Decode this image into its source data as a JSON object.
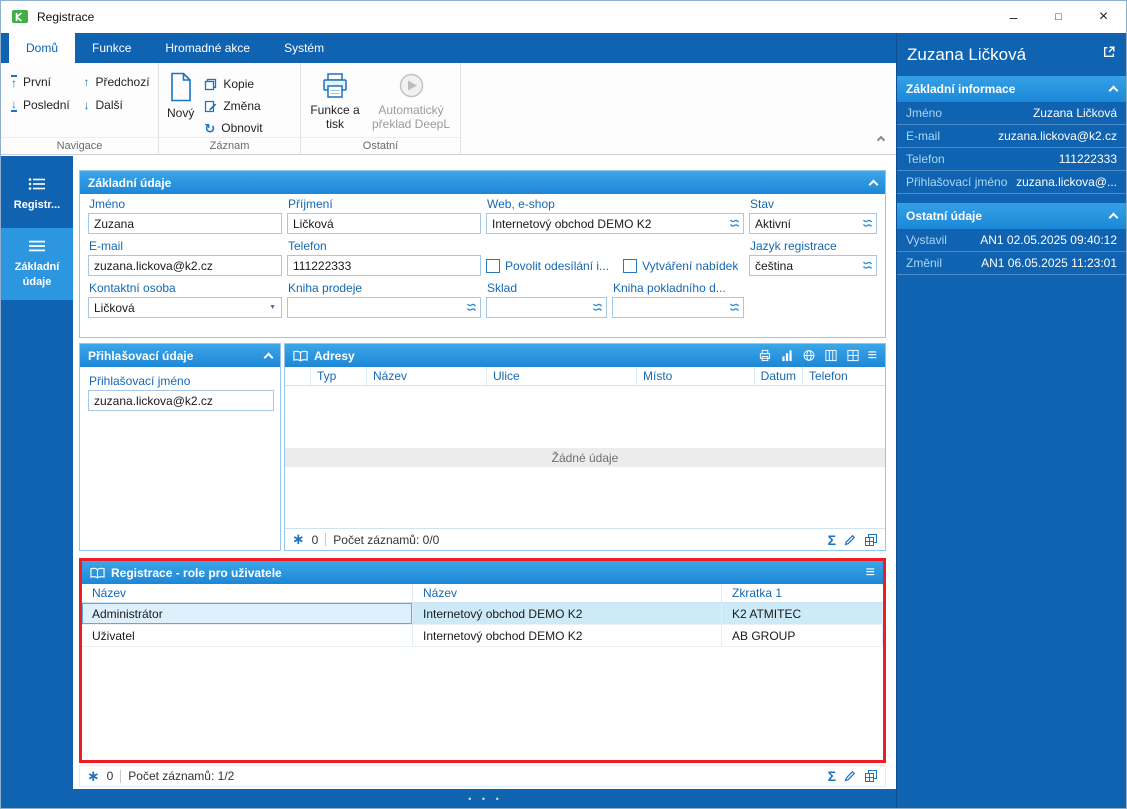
{
  "window": {
    "title": "Registrace"
  },
  "icons": {
    "minimize": "–",
    "maximize": "□",
    "close": "×",
    "menu": "≡",
    "sum": "Σ",
    "flag": "∗",
    "combo_arrow": "▼",
    "arrow_up": "↑",
    "arrow_down": "↓",
    "refresh": "↻",
    "dots": "• • •"
  },
  "colors": {
    "accent_blue": "#0f63b1",
    "header_blue": "#1d87d7",
    "highlight_red": "#ee1c25",
    "selected_row": "#cdeaf9"
  },
  "ribbon": {
    "tabs": [
      {
        "label": "Domů"
      },
      {
        "label": "Funkce"
      },
      {
        "label": "Hromadné akce"
      },
      {
        "label": "Systém"
      }
    ],
    "navigace": {
      "label": "Navigace",
      "first": "První",
      "prev": "Předchozí",
      "last": "Poslední",
      "next": "Další"
    },
    "zaznam": {
      "label": "Záznam",
      "new": "Nový",
      "copy": "Kopie",
      "change": "Změna",
      "refresh": "Obnovit"
    },
    "ostatni": {
      "label": "Ostatní",
      "print": "Funkce a tisk",
      "deepl": "Automatický překlad DeepL"
    }
  },
  "nav_sidebar": {
    "item1": "Registr...",
    "item2": "Základní údaje"
  },
  "form": {
    "title": "Základní údaje",
    "jmeno_label": "Jméno",
    "jmeno": "Zuzana",
    "prijmeni_label": "Příjmení",
    "prijmeni": "Ličková",
    "web_label": "Web, e-shop",
    "web": "Internetový obchod DEMO K2",
    "stav_label": "Stav",
    "stav": "Aktivní",
    "email_label": "E-mail",
    "email": "zuzana.lickova@k2.cz",
    "telefon_label": "Telefon",
    "telefon": "111222333",
    "povolit_label": "Povolit odesílání i...",
    "nabidky_label": "Vytváření nabídek",
    "jazyk_label": "Jazyk registrace",
    "jazyk": "čeština",
    "kontakt_label": "Kontaktní osoba",
    "kontakt": "Ličková",
    "kniha_prodeje_label": "Kniha prodeje",
    "sklad_label": "Sklad",
    "kniha_pokl_label": "Kniha pokladního d..."
  },
  "login": {
    "title": "Přihlašovací údaje",
    "label": "Přihlašovací jméno",
    "value": "zuzana.lickova@k2.cz"
  },
  "addresses": {
    "title": "Adresy",
    "columns": [
      "Typ",
      "Název",
      "Ulice",
      "Místo",
      "Datum",
      "Telefon"
    ],
    "empty": "Žádné údaje",
    "count": "0",
    "records": "Počet záznamů: 0/0"
  },
  "roles": {
    "title": "Registrace - role pro uživatele",
    "columns": [
      "Název",
      "Název",
      "Zkratka 1"
    ],
    "rows": [
      {
        "c1": "Administrátor",
        "c2": "Internetový obchod DEMO K2",
        "c3": "K2 ATMITEC"
      },
      {
        "c1": "Uživatel",
        "c2": "Internetový obchod DEMO K2",
        "c3": "AB GROUP"
      }
    ],
    "count": "0",
    "records": "Počet záznamů: 1/2"
  },
  "preview": {
    "title": "Zuzana Ličková",
    "sections": [
      {
        "title": "Základní informace",
        "rows": [
          {
            "label": "Jméno",
            "value": "Zuzana Ličková"
          },
          {
            "label": "E-mail",
            "value": "zuzana.lickova@k2.cz"
          },
          {
            "label": "Telefon",
            "value": "111222333"
          },
          {
            "label": "Přihlašovací jméno",
            "value": "zuzana.lickova@..."
          }
        ]
      },
      {
        "title": "Ostatní údaje",
        "rows": [
          {
            "label": "Vystavil",
            "value": "AN1 02.05.2025 09:40:12"
          },
          {
            "label": "Změnil",
            "value": "AN1 06.05.2025 11:23:01"
          }
        ]
      }
    ]
  }
}
